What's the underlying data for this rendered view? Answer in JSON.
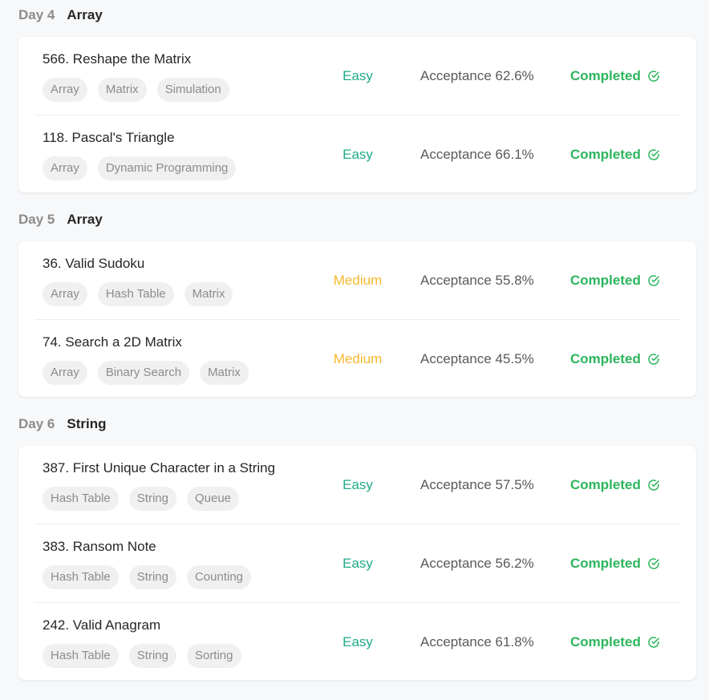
{
  "colors": {
    "easy": "#1fab89",
    "medium": "#f5b82e",
    "completed": "#2db55d"
  },
  "days": [
    {
      "label": "Day 4",
      "topic": "Array",
      "problems": [
        {
          "title": "566. Reshape the Matrix",
          "tags": [
            "Array",
            "Matrix",
            "Simulation"
          ],
          "difficulty": "Easy",
          "acceptance": "Acceptance 62.6%",
          "status": "Completed"
        },
        {
          "title": "118. Pascal's Triangle",
          "tags": [
            "Array",
            "Dynamic Programming"
          ],
          "difficulty": "Easy",
          "acceptance": "Acceptance 66.1%",
          "status": "Completed"
        }
      ]
    },
    {
      "label": "Day 5",
      "topic": "Array",
      "problems": [
        {
          "title": "36. Valid Sudoku",
          "tags": [
            "Array",
            "Hash Table",
            "Matrix"
          ],
          "difficulty": "Medium",
          "acceptance": "Acceptance 55.8%",
          "status": "Completed"
        },
        {
          "title": "74. Search a 2D Matrix",
          "tags": [
            "Array",
            "Binary Search",
            "Matrix"
          ],
          "difficulty": "Medium",
          "acceptance": "Acceptance 45.5%",
          "status": "Completed"
        }
      ]
    },
    {
      "label": "Day 6",
      "topic": "String",
      "problems": [
        {
          "title": "387. First Unique Character in a String",
          "tags": [
            "Hash Table",
            "String",
            "Queue"
          ],
          "difficulty": "Easy",
          "acceptance": "Acceptance 57.5%",
          "status": "Completed"
        },
        {
          "title": "383. Ransom Note",
          "tags": [
            "Hash Table",
            "String",
            "Counting"
          ],
          "difficulty": "Easy",
          "acceptance": "Acceptance 56.2%",
          "status": "Completed"
        },
        {
          "title": "242. Valid Anagram",
          "tags": [
            "Hash Table",
            "String",
            "Sorting"
          ],
          "difficulty": "Easy",
          "acceptance": "Acceptance 61.8%",
          "status": "Completed"
        }
      ]
    }
  ]
}
